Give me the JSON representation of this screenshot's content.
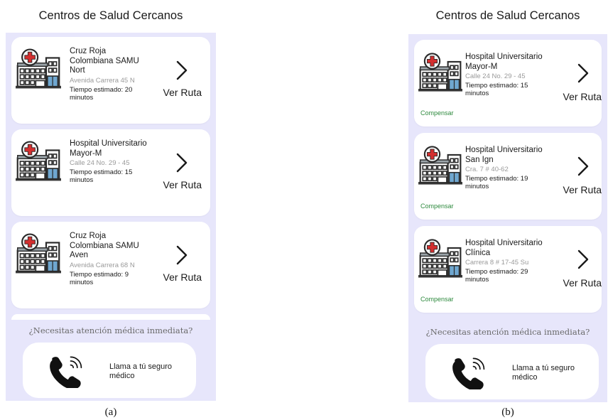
{
  "panel_a": {
    "title": "Centros de Salud Cercanos",
    "cards": [
      {
        "name": "Cruz Roja Colombiana SAMU Nort",
        "address": "Avenida Carrera 45 N",
        "time": "Tiempo estimado: 20 minutos",
        "action": "Ver Ruta"
      },
      {
        "name": "Hospital Universitario Mayor-M",
        "address": "Calle 24 No. 29 - 45",
        "time": "Tiempo estimado: 15 minutos",
        "action": "Ver Ruta"
      },
      {
        "name": "Cruz Roja Colombiana SAMU Aven",
        "address": "Avenida Carrera 68 N",
        "time": "Tiempo estimado: 9 minutos",
        "action": "Ver Ruta"
      }
    ],
    "question": "¿Necesitas atención médica inmediata?",
    "call_label": "Llama a tú seguro médico",
    "caption": "(a)"
  },
  "panel_b": {
    "title": "Centros de Salud Cercanos",
    "cards": [
      {
        "name": "Hospital Universitario Mayor-M",
        "address": "Calle 24 No. 29 - 45",
        "time": "Tiempo estimado: 15 minutos",
        "action": "Ver Ruta",
        "badge": "Compensar"
      },
      {
        "name": "Hospital Universitario San Ign",
        "address": "Cra. 7 # 40-62",
        "time": "Tiempo estimado: 19 minutos",
        "action": "Ver Ruta",
        "badge": "Compensar"
      },
      {
        "name": "Hospital Universitario Clínica",
        "address": "Carrera 8 # 17-45 Su",
        "time": "Tiempo estimado: 29 minutos",
        "action": "Ver Ruta",
        "badge": "Compensar"
      }
    ],
    "question": "¿Necesitas atención médica inmediata?",
    "call_label": "Llama a tú seguro médico",
    "caption": "(b)"
  },
  "icons": {
    "hospital": "hospital-building-icon",
    "chevron": "chevron-right-icon",
    "phone": "phone-call-icon"
  },
  "colors": {
    "screen_bg": "#e7e6fb",
    "card_bg": "#ffffff",
    "cross_red": "#d32f2f",
    "badge_green": "#2e8a3e",
    "address_gray": "#9a9a9a"
  }
}
